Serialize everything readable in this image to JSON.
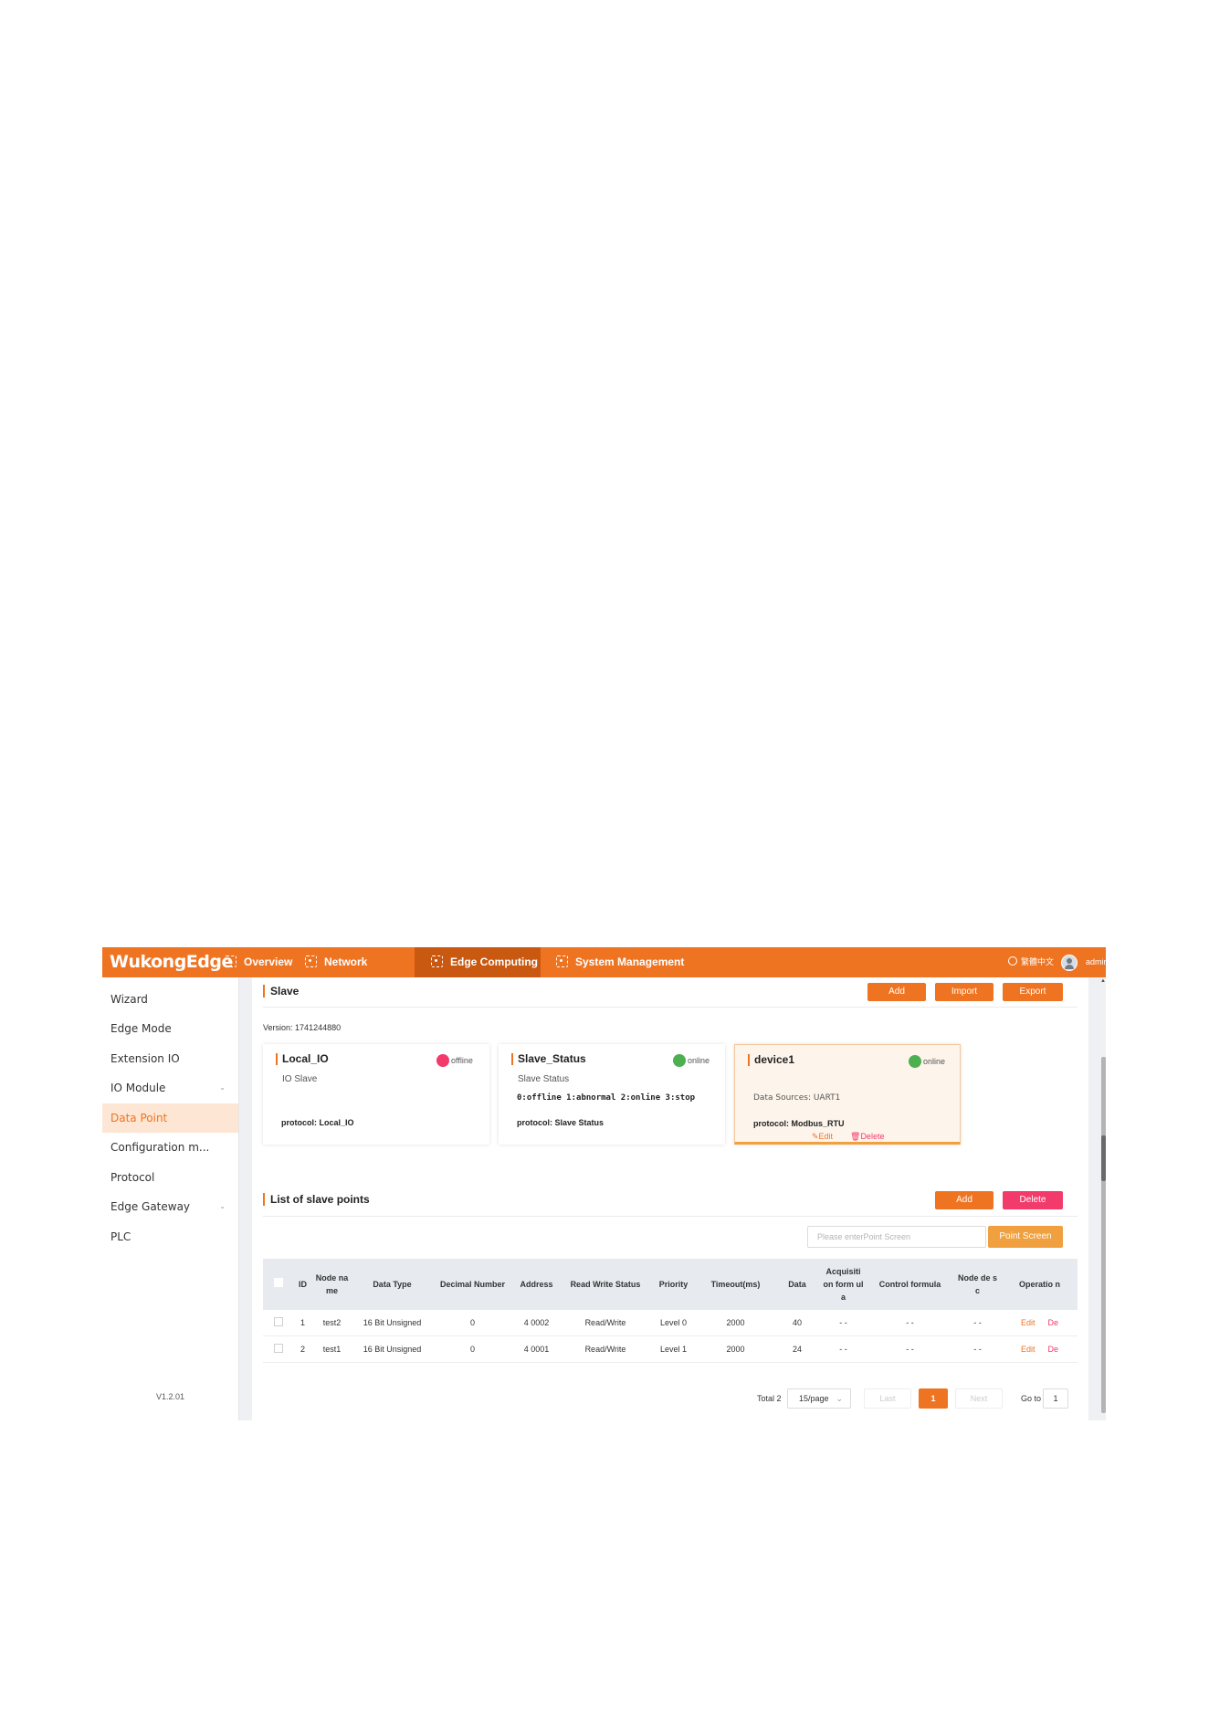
{
  "brand": {
    "logo": "WukongEdge",
    "accent": "#ef7422",
    "danger": "#f23a6b",
    "online": "#4caf50"
  },
  "nav": {
    "items": [
      {
        "label": "Overview",
        "icon": "scan-icon"
      },
      {
        "label": "Network",
        "icon": "scan-icon"
      },
      {
        "label": "Edge Computing",
        "icon": "scan-icon",
        "active": true
      },
      {
        "label": "System Management",
        "icon": "scan-icon"
      }
    ],
    "language": "繁體中文",
    "user": "admin"
  },
  "sidebar": {
    "items": [
      {
        "label": "Wizard"
      },
      {
        "label": "Edge Mode"
      },
      {
        "label": "Extension IO"
      },
      {
        "label": "IO Module",
        "expandable": true
      },
      {
        "label": "Data Point",
        "active": true
      },
      {
        "label": "Configuration m..."
      },
      {
        "label": "Protocol"
      },
      {
        "label": "Edge Gateway",
        "expandable": true
      },
      {
        "label": "PLC"
      }
    ],
    "version": "V1.2.01"
  },
  "slave": {
    "title": "Slave",
    "buttons": {
      "add": "Add",
      "import": "Import",
      "export": "Export"
    },
    "version_label": "Version:",
    "version_value": "1741244880",
    "cards": [
      {
        "name": "Local_IO",
        "status": "offline",
        "desc": "IO Slave",
        "line2": "",
        "protocol_label": "protocol:",
        "protocol": "Local_IO"
      },
      {
        "name": "Slave_Status",
        "status": "online",
        "desc": "Slave Status",
        "line2": "0:offline 1:abnormal 2:online 3:stop",
        "protocol_label": "protocol:",
        "protocol": "Slave Status"
      },
      {
        "name": "device1",
        "status": "online",
        "desc": "",
        "line2": "Data Sources: UART1",
        "protocol_label": "protocol:",
        "protocol": "Modbus_RTU",
        "edit": "Edit",
        "delete": "Delete"
      }
    ]
  },
  "points": {
    "title": "List of slave points",
    "buttons": {
      "add": "Add",
      "delete": "Delete"
    },
    "search_placeholder": "Please enterPoint Screen",
    "search_button": "Point Screen",
    "columns": [
      "ID",
      "Node na me",
      "Data Type",
      "Decimal Number",
      "Address",
      "Read Write Status",
      "Priority",
      "Timeout(ms)",
      "Data",
      "Acquisiti on form ula",
      "Control formula",
      "Node de sc",
      "Operatio n"
    ],
    "rows": [
      {
        "id": "1",
        "node_name": "test2",
        "data_type": "16 Bit Unsigned",
        "decimal": "0",
        "address": "4 0002",
        "rw": "Read/Write",
        "priority": "Level 0",
        "timeout": "2000",
        "data": "40",
        "acq": "- -",
        "ctrl": "- -",
        "desc": "- -",
        "edit": "Edit",
        "del": "De"
      },
      {
        "id": "2",
        "node_name": "test1",
        "data_type": "16 Bit Unsigned",
        "decimal": "0",
        "address": "4 0001",
        "rw": "Read/Write",
        "priority": "Level 1",
        "timeout": "2000",
        "data": "24",
        "acq": "- -",
        "ctrl": "- -",
        "desc": "- -",
        "edit": "Edit",
        "del": "De"
      }
    ],
    "pagination": {
      "total": "Total 2",
      "page_size": "15/page",
      "prev": "Last",
      "current": "1",
      "next": "Next",
      "goto_label": "Go to",
      "goto_value": "1"
    }
  }
}
